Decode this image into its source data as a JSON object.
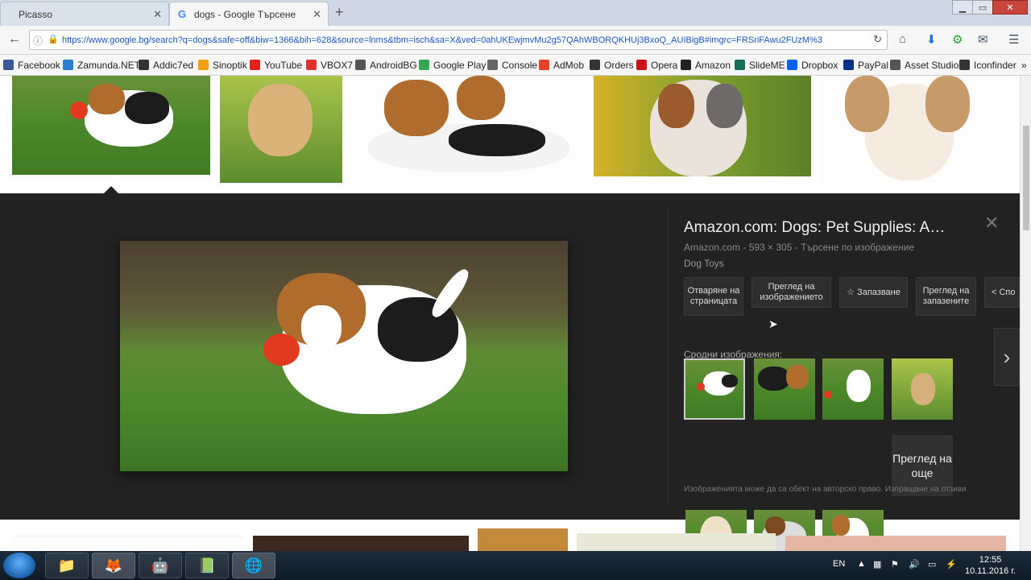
{
  "tabs": [
    {
      "title": "Picasso",
      "active": false
    },
    {
      "title": "dogs - Google Търсене",
      "active": true
    }
  ],
  "address": {
    "url": "https://www.google.bg/search?q=dogs&safe=off&biw=1366&bih=628&source=lnms&tbm=isch&sa=X&ved=0ahUKEwjmvMu2g57QAhWBORQKHUj3BxoQ_AUIBigB#imgrc=FRSriFAwu2FUzM%3"
  },
  "toolbar_icons": [
    "home-icon",
    "download-icon",
    "extension-icon",
    "mail-icon",
    "menu-icon"
  ],
  "bookmarks": [
    {
      "label": "Facebook",
      "color": "#3b5998"
    },
    {
      "label": "Zamunda.NET",
      "color": "#2a7fd4"
    },
    {
      "label": "Addic7ed",
      "color": "#333333"
    },
    {
      "label": "Sinoptik",
      "color": "#f0a000"
    },
    {
      "label": "YouTube",
      "color": "#e62117"
    },
    {
      "label": "VBOX7",
      "color": "#e03030"
    },
    {
      "label": "AndroidBG",
      "color": "#555555"
    },
    {
      "label": "Google Play",
      "color": "#34a853"
    },
    {
      "label": "Console",
      "color": "#666666"
    },
    {
      "label": "AdMob",
      "color": "#e8412b"
    },
    {
      "label": "Orders",
      "color": "#333333"
    },
    {
      "label": "Opera",
      "color": "#cc0f16"
    },
    {
      "label": "Amazon",
      "color": "#222222"
    },
    {
      "label": "SlideME",
      "color": "#1a6e5c"
    },
    {
      "label": "Dropbox",
      "color": "#0061fe"
    },
    {
      "label": "PayPal",
      "color": "#003087"
    },
    {
      "label": "Asset Studio",
      "color": "#555555"
    },
    {
      "label": "Iconfinder",
      "color": "#333333"
    },
    {
      "label": "»",
      "color": ""
    }
  ],
  "panel": {
    "title": "Amazon.com: Dogs: Pet Supplies: A…",
    "subtitle": "Amazon.com - 593 × 305 - Търсене по изображение",
    "category": "Dog Toys",
    "buttons": [
      {
        "label": "Отваряне на страницата"
      },
      {
        "label": "Преглед на изображението"
      },
      {
        "label": "☆ Запазване"
      },
      {
        "label": "Преглед на запазените"
      },
      {
        "label": "< Спо"
      }
    ],
    "similar_label": "Сродни изображения:",
    "more_label": "Преглед на още",
    "feedback": "Изображенията може да са обект на авторско право. Изпращане на отзиви"
  },
  "taskbar": {
    "lang": "EN",
    "time": "12:55",
    "date": "10.11.2016 г."
  }
}
